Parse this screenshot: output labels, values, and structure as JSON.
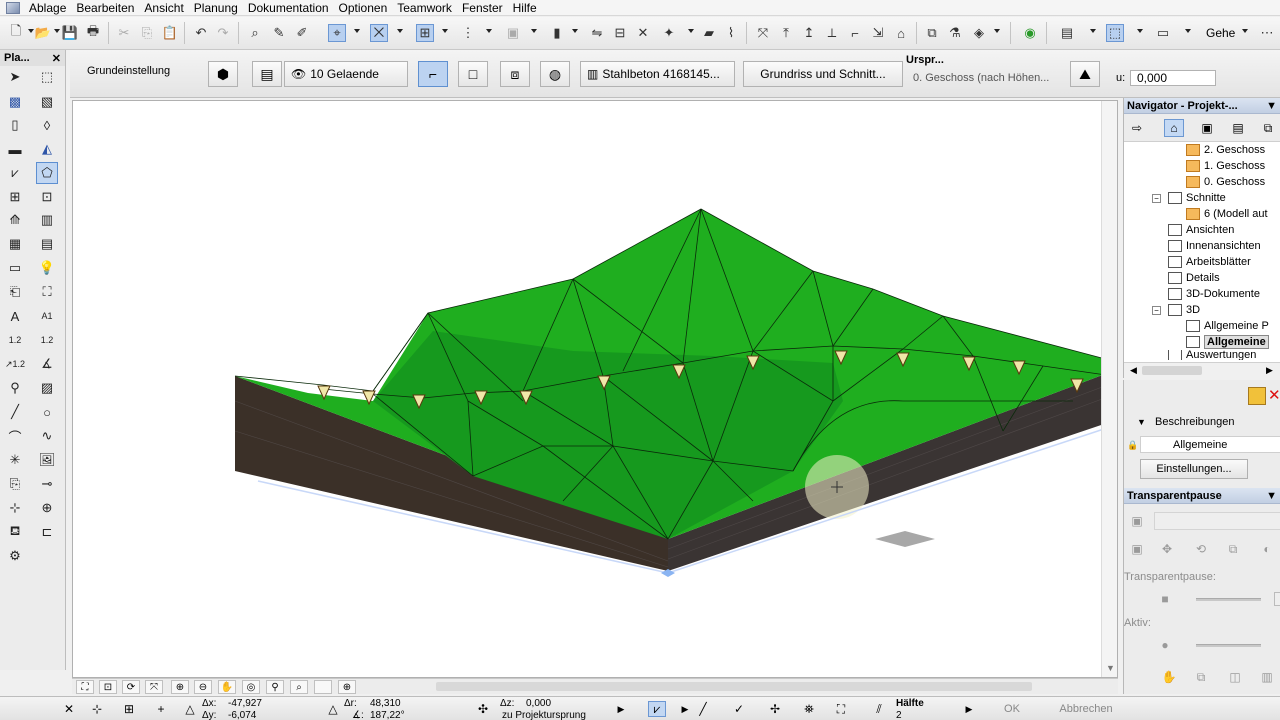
{
  "menu": [
    "Ablage",
    "Bearbeiten",
    "Ansicht",
    "Planung",
    "Dokumentation",
    "Optionen",
    "Teamwork",
    "Fenster",
    "Hilfe"
  ],
  "toolbar": {
    "gehe_label": "Gehe"
  },
  "palette": {
    "title": "Pla..."
  },
  "infobox": {
    "preset": "Grundeinstellung",
    "layer": "10 Gelaende",
    "material": "Stahlbeton 4168145...",
    "view_button": "Grundriss und Schnitt...",
    "origin_label": "Urspr...",
    "origin_value": "0. Geschoss  (nach Höhen...",
    "u_label": "u:",
    "u_value": "0,000"
  },
  "coords": {
    "dx_label": "Δx:",
    "dx": "-47,927",
    "dy_label": "Δy:",
    "dy": "-6,074",
    "dr_label": "Δr:",
    "dr": "48,310",
    "angle_label": "∡:",
    "angle": "187,22°",
    "dz_label": "Δz:",
    "dz": "0,000",
    "dz_ref": "zu Projektursprung",
    "half_label": "Hälfte",
    "half_value": "2",
    "ok": "OK",
    "cancel": "Abbrechen"
  },
  "navigator": {
    "title": "Navigator - Projekt-...",
    "tree": [
      {
        "label": "2. Geschoss",
        "icon": "folder"
      },
      {
        "label": "1. Geschoss",
        "icon": "folder"
      },
      {
        "label": "0. Geschoss",
        "icon": "folder"
      },
      {
        "label": "Schnitte",
        "icon": "doc"
      },
      {
        "label": "6 (Modell aut",
        "icon": "folder"
      },
      {
        "label": "Ansichten",
        "icon": "doc"
      },
      {
        "label": "Innenansichten",
        "icon": "doc"
      },
      {
        "label": "Arbeitsblätter",
        "icon": "doc"
      },
      {
        "label": "Details",
        "icon": "doc"
      },
      {
        "label": "3D-Dokumente",
        "icon": "doc"
      },
      {
        "label": "3D",
        "icon": "doc"
      },
      {
        "label": "Allgemeine P",
        "icon": "doc"
      },
      {
        "label": "Allgemeine",
        "icon": "doc"
      },
      {
        "label": "Auswertungen",
        "icon": "doc"
      }
    ]
  },
  "descriptions": {
    "header": "Beschreibungen",
    "name": "Allgemeine",
    "settings_button": "Einstellungen..."
  },
  "transparent_panel": {
    "title": "Transparentpause",
    "pause_label": "Transparentpause:",
    "active_label": "Aktiv:"
  },
  "colors": {
    "terrain_top": "#1fae1f",
    "terrain_side": "#3a3028",
    "panel_header": "#c8d5e8",
    "selection": "#c2d7f2"
  }
}
